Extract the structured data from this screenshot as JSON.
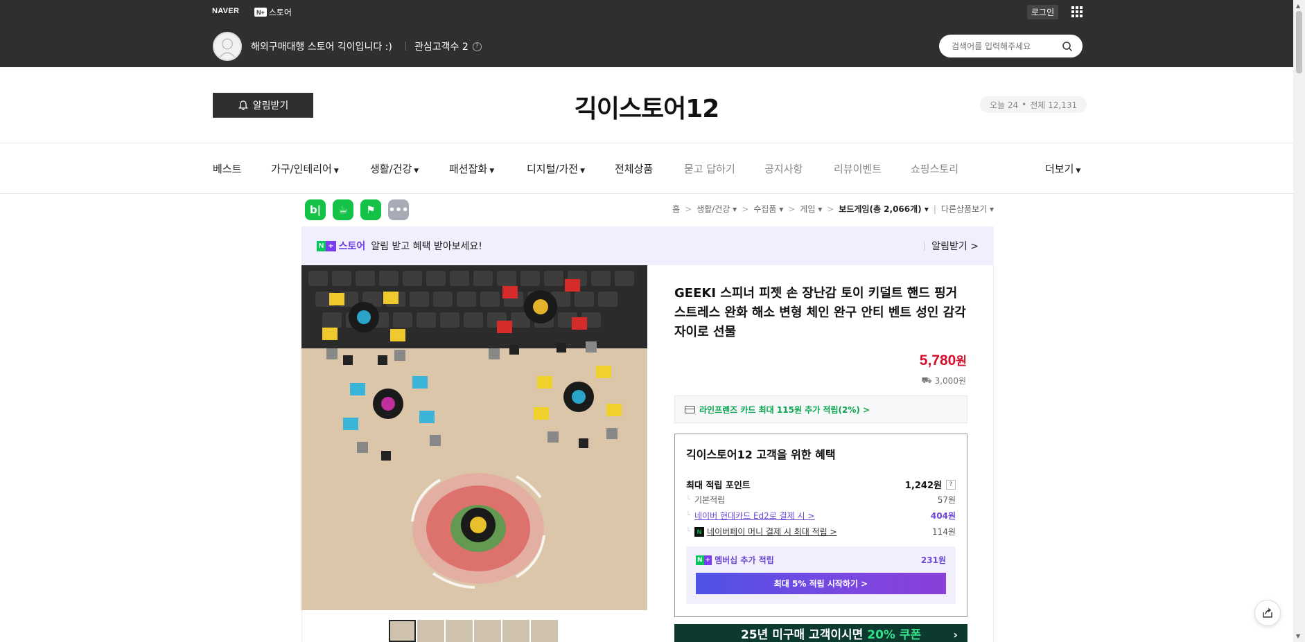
{
  "topbar": {
    "naver_logo": "NAVER",
    "store_badge": "N+",
    "store_label": "스토어",
    "login": "로그인",
    "store_desc": "해외구매대행 스토어 긱이입니다 :)",
    "interest_label": "관심고객수 2",
    "search_placeholder": "검색어를 입력해주세요"
  },
  "header": {
    "alarm_button": "알림받기",
    "store_title": "긱이스토어12",
    "visit_today": "오늘 24",
    "visit_dot": "•",
    "visit_total": "전체 12,131"
  },
  "nav": {
    "items": [
      {
        "label": "베스트"
      },
      {
        "label": "가구/인테리어"
      },
      {
        "label": "생활/건강"
      },
      {
        "label": "패션잡화"
      },
      {
        "label": "디지털/가전"
      },
      {
        "label": "전체상품"
      },
      {
        "label": "묻고 답하기"
      },
      {
        "label": "공지사항"
      },
      {
        "label": "리뷰이벤트"
      },
      {
        "label": "쇼핑스토리"
      }
    ],
    "more": "더보기"
  },
  "breadcrumb": {
    "home": "홈",
    "c1": "생활/건강",
    "c2": "수집품",
    "c3": "게임",
    "c4": "보드게임(총 2,066개)",
    "other": "다른상품보기"
  },
  "promo": {
    "badge_n": "N",
    "badge_plus": "+",
    "store_word": "스토어",
    "text": "알림 받고 혜택 받아보세요!",
    "action": "알림받기 >"
  },
  "product": {
    "title": "GEEKI 스피너 피젯 손 장난감 토이 키덜트 핸드 핑거 스트레스 완화 해소 변형 체인 완구 안티 벤트 성인 감각 자이로 선물",
    "price_num": "5,780",
    "price_unit": "원",
    "delivery": "3,000원",
    "card_offer": "라인프렌즈 카드 최대 115원 추가 적립(2%) >"
  },
  "benefit": {
    "title": "긱이스토어12 고객을 위한 혜택",
    "max_points_label": "최대 적립 포인트",
    "max_points_value": "1,242원",
    "help": "?",
    "rows": [
      {
        "label": "기본적립",
        "value": "57원"
      },
      {
        "label": "네이버 현대카드 Ed2로 결제 시 >",
        "value": "404원"
      },
      {
        "label": "네이버페이 머니 결제 시 최대 적립 >",
        "value": "114원"
      }
    ],
    "member_label": "멤버십 추가 적립",
    "member_value": "231원",
    "member_cta": "최대 5% 적립 시작하기 >"
  },
  "banner": {
    "text": "25년 미구매 고객이시면",
    "highlight": "20% 쿠폰"
  },
  "colors": {
    "topbar": "#2f2f2f",
    "price": "#d3112d",
    "accent_green": "#03c75a",
    "accent_purple": "#6a47d4"
  }
}
